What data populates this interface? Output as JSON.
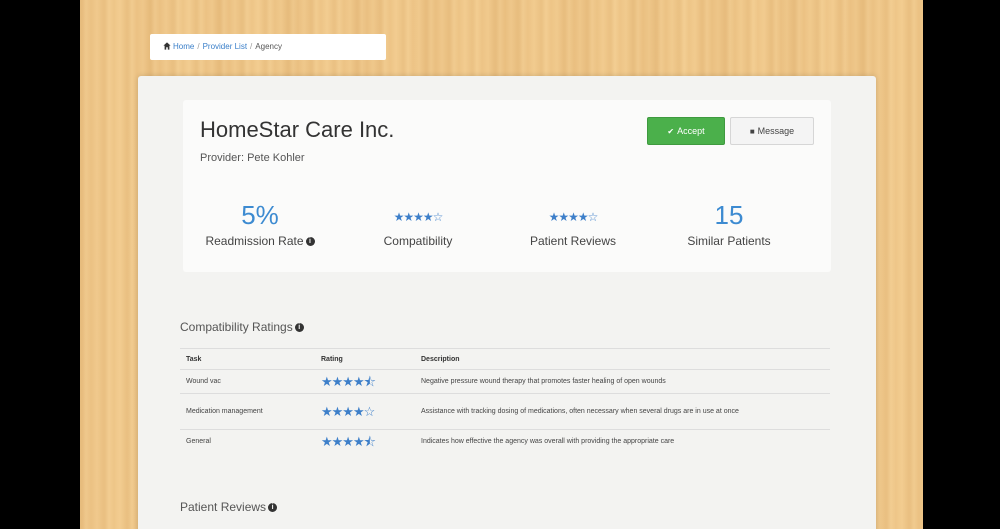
{
  "breadcrumb": {
    "home_label": "Home",
    "separator": "/",
    "provider_list_label": "Provider List",
    "current_label": "Agency"
  },
  "agency": {
    "name": "HomeStar Care Inc.",
    "provider": "Provider: Pete Kohler"
  },
  "actions": {
    "accept_label": "Accept",
    "message_label": "Message"
  },
  "stats": {
    "readmission_rate": {
      "value": "5%",
      "label": "Readmission Rate"
    },
    "compatibility": {
      "rating": 4,
      "max": 5,
      "stars": "★★★★☆",
      "label": "Compatibility"
    },
    "patient_reviews": {
      "rating": 4,
      "max": 5,
      "stars": "★★★★☆",
      "label": "Patient Reviews"
    },
    "similar_patients": {
      "value": "15",
      "label": "Similar Patients"
    }
  },
  "compatibility_ratings": {
    "title": "Compatibility Ratings",
    "columns": [
      "Task",
      "Rating",
      "Description"
    ],
    "rows": [
      {
        "task": "Wound vac",
        "rating": 4.5,
        "stars": "★★★★⯪",
        "description": "Negative pressure wound therapy that promotes faster healing of open wounds"
      },
      {
        "task": "Medication management",
        "rating": 4,
        "stars": "★★★★☆",
        "description": "Assistance with tracking dosing of medications, often necessary when several drugs are in use at once"
      },
      {
        "task": "General",
        "rating": 4.5,
        "stars": "★★★★⯪",
        "description": "Indicates how effective the agency was overall with providing the appropriate care"
      }
    ]
  },
  "patient_reviews": {
    "title": "Patient Reviews"
  },
  "colors": {
    "accent_blue": "#3d8bd1",
    "accept_green": "#4bb04b",
    "wood_background": "#f1c98b"
  }
}
